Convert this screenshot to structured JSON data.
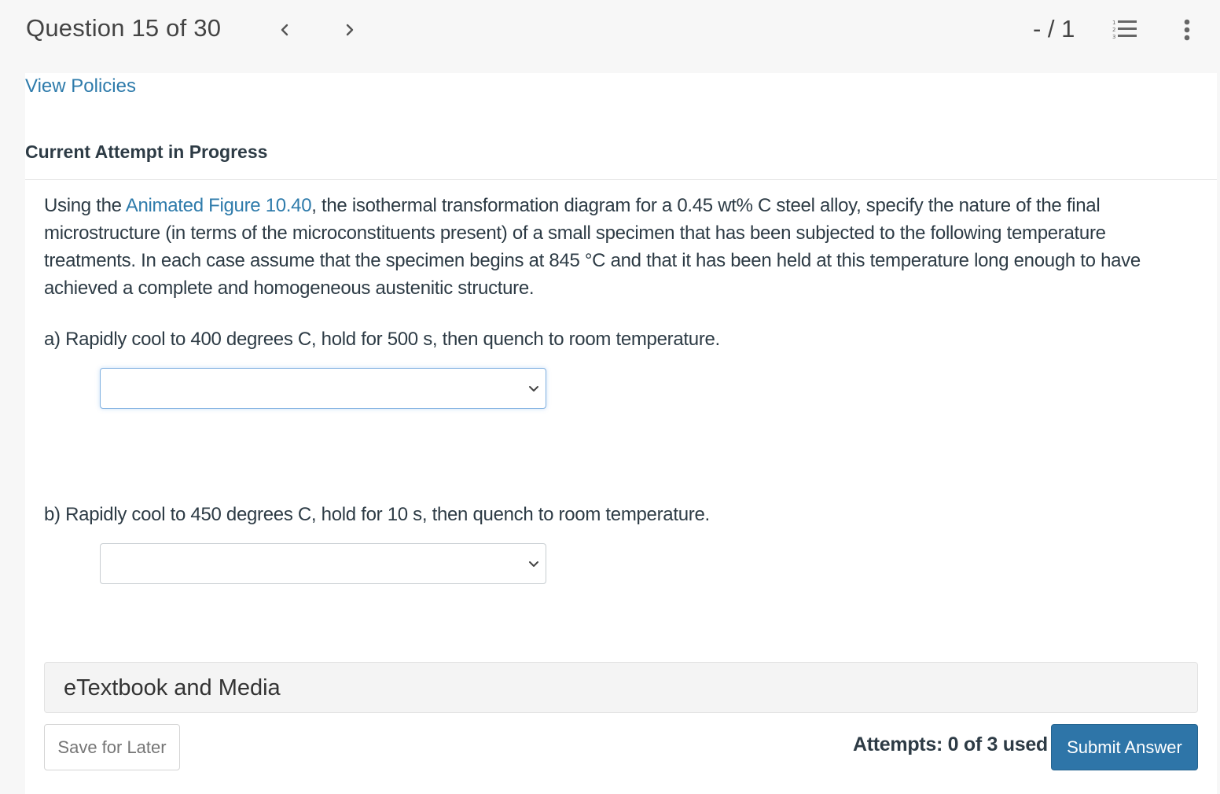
{
  "header": {
    "question_title": "Question 15 of 30",
    "prev_icon": "chevron-left-icon",
    "next_icon": "chevron-right-icon",
    "score": "- / 1",
    "list_icon": "numbered-list-icon",
    "more_icon": "more-vertical-icon"
  },
  "policies_link": "View Policies",
  "attempt_heading": "Current Attempt in Progress",
  "question": {
    "text_before_link": "Using the ",
    "link_text": "Animated Figure 10.40",
    "text_after_link": ", the isothermal transformation diagram for a 0.45 wt% C steel alloy, specify the nature of the final microstructure (in terms of the microconstituents present) of a small specimen that has been subjected to the following temperature treatments. In each case assume that the specimen begins at 845 °C and that it has been held at this temperature long enough to have achieved a complete and homogeneous austenitic structure."
  },
  "parts": [
    {
      "label": "a) Rapidly cool to 400 degrees C, hold for 500 s, then quench to room temperature.",
      "selected_value": ""
    },
    {
      "label": "b) Rapidly cool to 450 degrees C, hold for 10 s, then quench to room temperature.",
      "selected_value": ""
    }
  ],
  "etextbook_label": "eTextbook and Media",
  "footer": {
    "save_label": "Save for Later",
    "attempts_text": "Attempts: 0 of 3 used",
    "submit_label": "Submit Answer"
  },
  "colors": {
    "link": "#2e7bab",
    "submit_bg": "#2e75a8",
    "header_bg": "#f7f7f7",
    "text": "#2d3b45"
  }
}
